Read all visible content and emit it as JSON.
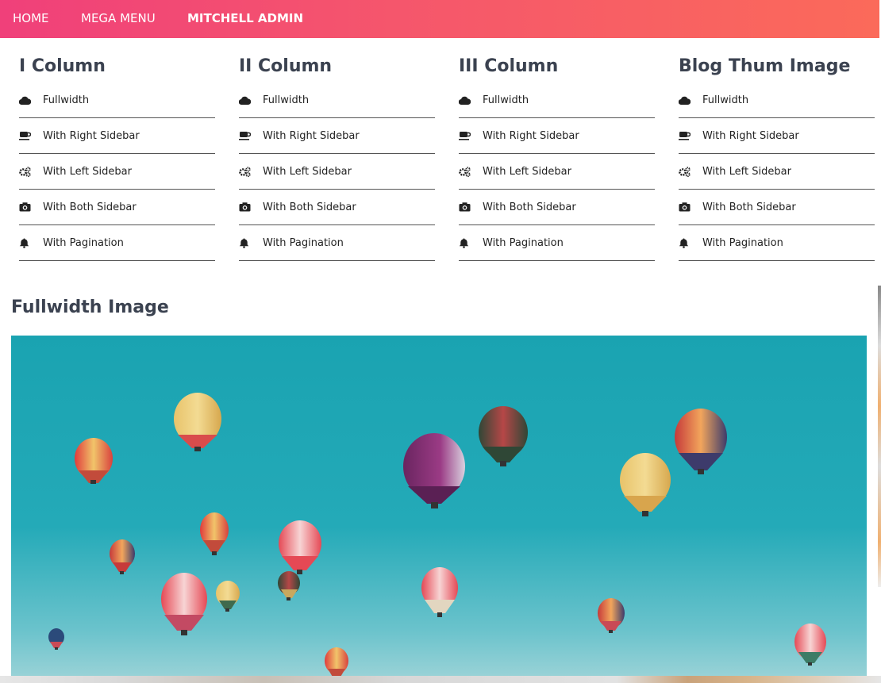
{
  "nav": {
    "items": [
      {
        "label": "HOME"
      },
      {
        "label": "MEGA MENU"
      },
      {
        "label": "MITCHELL ADMIN"
      }
    ]
  },
  "columns": [
    {
      "title": "I Column",
      "items": [
        {
          "icon": "cloud-icon",
          "label": "Fullwidth"
        },
        {
          "icon": "coffee-icon",
          "label": "With Right Sidebar"
        },
        {
          "icon": "cogs-icon",
          "label": "With Left Sidebar"
        },
        {
          "icon": "camera-icon",
          "label": "With Both Sidebar"
        },
        {
          "icon": "bell-icon",
          "label": "With Pagination"
        }
      ]
    },
    {
      "title": "II Column",
      "items": [
        {
          "icon": "cloud-icon",
          "label": "Fullwidth"
        },
        {
          "icon": "coffee-icon",
          "label": "With Right Sidebar"
        },
        {
          "icon": "cogs-icon",
          "label": "With Left Sidebar"
        },
        {
          "icon": "camera-icon",
          "label": "With Both Sidebar"
        },
        {
          "icon": "bell-icon",
          "label": "With Pagination"
        }
      ]
    },
    {
      "title": "III Column",
      "items": [
        {
          "icon": "cloud-icon",
          "label": "Fullwidth"
        },
        {
          "icon": "coffee-icon",
          "label": "With Right Sidebar"
        },
        {
          "icon": "cogs-icon",
          "label": "With Left Sidebar"
        },
        {
          "icon": "camera-icon",
          "label": "With Both Sidebar"
        },
        {
          "icon": "bell-icon",
          "label": "With Pagination"
        }
      ]
    },
    {
      "title": "Blog Thum Image",
      "items": [
        {
          "icon": "cloud-icon",
          "label": "Fullwidth"
        },
        {
          "icon": "coffee-icon",
          "label": "With Right Sidebar"
        },
        {
          "icon": "cogs-icon",
          "label": "With Left Sidebar"
        },
        {
          "icon": "camera-icon",
          "label": "With Both Sidebar"
        },
        {
          "icon": "bell-icon",
          "label": "With Pagination"
        }
      ]
    }
  ],
  "image_section": {
    "title": "Fullwidth Image"
  },
  "colors": {
    "nav_start": "#f0407a",
    "nav_end": "#fb6a5a",
    "sky": "#1aa3b1"
  }
}
